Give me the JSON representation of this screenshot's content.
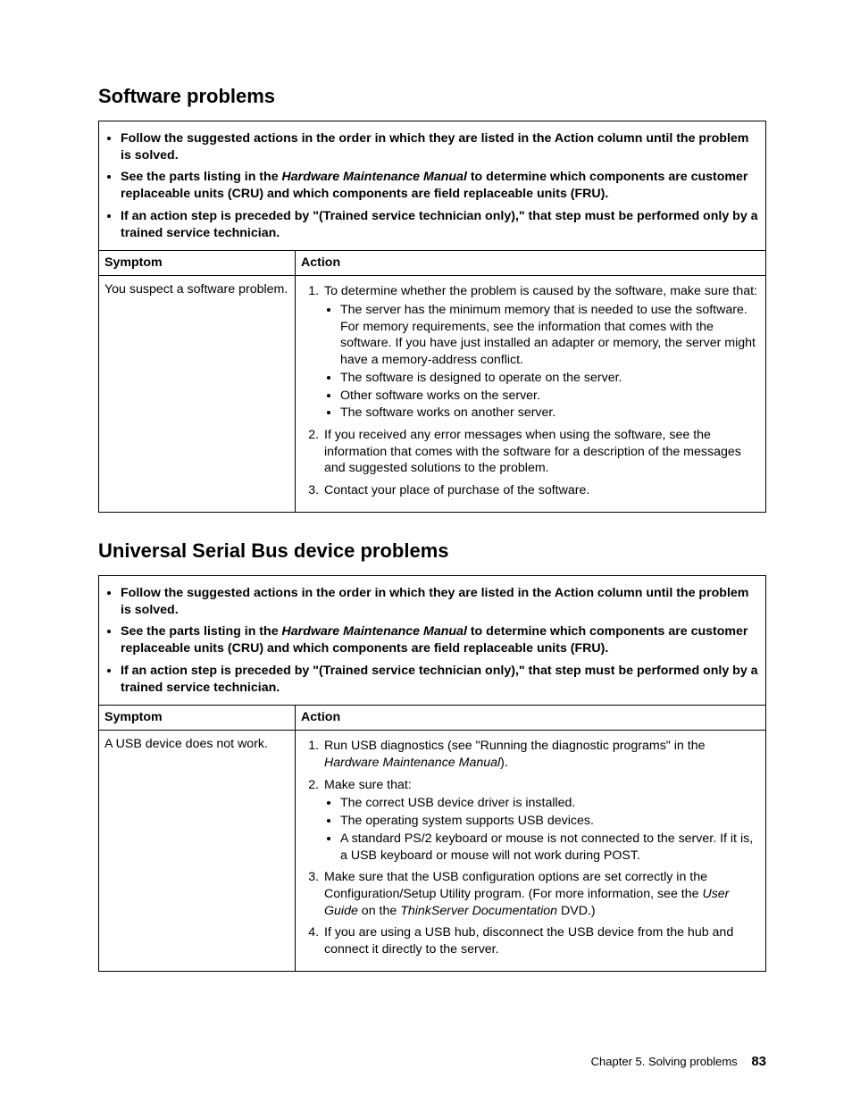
{
  "common": {
    "intro": {
      "b1": "Follow the suggested actions in the order in which they are listed in the Action column until the problem is solved.",
      "b2a": "See the parts listing in the ",
      "b2i": "Hardware Maintenance Manual",
      "b2b": " to determine which components are customer replaceable units (CRU) and which components are field replaceable units (FRU).",
      "b3": "If an action step is preceded by \"(Trained service technician only),\" that step must be performed only by a trained service technician."
    },
    "header_symptom": "Symptom",
    "header_action": "Action"
  },
  "section1": {
    "title": "Software problems",
    "symptom": "You suspect a software problem.",
    "a1_lead": "To determine whether the problem is caused by the software, make sure that:",
    "a1_sub": {
      "s1": "The server has the minimum memory that is needed to use the software. For memory requirements, see the information that comes with the software. If you have just installed an adapter or memory, the server might have a memory-address conflict.",
      "s2": "The software is designed to operate on the server.",
      "s3": "Other software works on the server.",
      "s4": "The software works on another server."
    },
    "a2": "If you received any error messages when using the software, see the information that comes with the software for a description of the messages and suggested solutions to the problem.",
    "a3": "Contact your place of purchase of the software."
  },
  "section2": {
    "title": "Universal Serial Bus device problems",
    "symptom": "A USB device does not work.",
    "a1_a": "Run USB diagnostics (see \"Running the diagnostic programs\" in the ",
    "a1_i": "Hardware Maintenance Manual",
    "a1_b": ").",
    "a2_lead": "Make sure that:",
    "a2_sub": {
      "s1": "The correct USB device driver is installed.",
      "s2": "The operating system supports USB devices.",
      "s3": "A standard PS/2 keyboard or mouse is not connected to the server. If it is, a USB keyboard or mouse will not work during POST."
    },
    "a3_a": "Make sure that the USB configuration options are set correctly in the Configuration/Setup Utility program. (For more information, see the ",
    "a3_i1": "User Guide",
    "a3_b": " on the ",
    "a3_i2": "ThinkServer Documentation",
    "a3_c": " DVD.)",
    "a4": "If you are using a USB hub, disconnect the USB device from the hub and connect it directly to the server."
  },
  "footer": {
    "chapter": "Chapter 5. Solving problems",
    "page": "83"
  }
}
